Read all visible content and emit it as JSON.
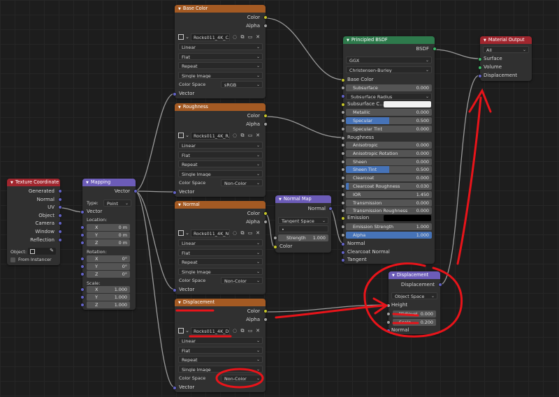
{
  "nodes": {
    "texture_coordinate": {
      "title": "Texture Coordinate",
      "outputs": [
        "Generated",
        "Normal",
        "UV",
        "Object",
        "Camera",
        "Window",
        "Reflection"
      ],
      "object_label": "Object:",
      "from_instancer": "From Instancer"
    },
    "mapping": {
      "title": "Mapping",
      "output": "Vector",
      "type_label": "Type:",
      "type_value": "Point",
      "input_vector": "Vector",
      "location_label": "Location:",
      "location": [
        {
          "axis": "X",
          "value": "0 m"
        },
        {
          "axis": "Y",
          "value": "0 m"
        },
        {
          "axis": "Z",
          "value": "0 m"
        }
      ],
      "rotation_label": "Rotation:",
      "rotation": [
        {
          "axis": "X",
          "value": "0°"
        },
        {
          "axis": "Y",
          "value": "0°"
        },
        {
          "axis": "Z",
          "value": "0°"
        }
      ],
      "scale_label": "Scale:",
      "scale": [
        {
          "axis": "X",
          "value": "1.000"
        },
        {
          "axis": "Y",
          "value": "1.000"
        },
        {
          "axis": "Z",
          "value": "1.000"
        }
      ]
    },
    "base_color": {
      "title": "Base Color",
      "out_color": "Color",
      "out_alpha": "Alpha",
      "image": "Rocks011_4K_C...",
      "interp": "Linear",
      "proj": "Flat",
      "ext": "Repeat",
      "source": "Single Image",
      "cs_label": "Color Space",
      "cs_value": "sRGB",
      "in_vector": "Vector"
    },
    "roughness": {
      "title": "Roughness",
      "out_color": "Color",
      "out_alpha": "Alpha",
      "image": "Rocks011_4K_R...",
      "interp": "Linear",
      "proj": "Flat",
      "ext": "Repeat",
      "source": "Single Image",
      "cs_label": "Color Space",
      "cs_value": "Non-Color",
      "in_vector": "Vector"
    },
    "normal": {
      "title": "Normal",
      "out_color": "Color",
      "out_alpha": "Alpha",
      "image": "Rocks011_4K_N...",
      "interp": "Linear",
      "proj": "Flat",
      "ext": "Repeat",
      "source": "Single Image",
      "cs_label": "Color Space",
      "cs_value": "Non-Color",
      "in_vector": "Vector"
    },
    "displacement_tex": {
      "title": "Displacement",
      "out_color": "Color",
      "out_alpha": "Alpha",
      "image": "Rocks011_4K_D...",
      "interp": "Linear",
      "proj": "Flat",
      "ext": "Repeat",
      "source": "Single Image",
      "cs_label": "Color Space",
      "cs_value": "Non-Color",
      "in_vector": "Vector"
    },
    "normal_map": {
      "title": "Normal Map",
      "output": "Normal",
      "space": "Tangent Space",
      "uv": "•",
      "strength_label": "Strength",
      "strength_value": "1.000",
      "in_color": "Color"
    },
    "principled": {
      "title": "Principled BSDF",
      "output": "BSDF",
      "distribution": "GGX",
      "subsurface_method": "Christensen-Burley",
      "base_color": "Base Color",
      "fields": [
        {
          "label": "Subsurface",
          "value": "0.000",
          "fill": 0
        },
        {
          "label": "Subsurface Radius",
          "value": "",
          "fill": 0,
          "dropdown": true
        },
        {
          "label": "Subsurface C...",
          "value": "",
          "fill": 0,
          "swatch": "#f2f2f2"
        },
        {
          "label": "Metallic",
          "value": "0.000",
          "fill": 0
        },
        {
          "label": "Specular",
          "value": "0.500",
          "fill": 0.5
        },
        {
          "label": "Specular Tint",
          "value": "0.000",
          "fill": 0
        }
      ],
      "roughness": "Roughness",
      "fields2": [
        {
          "label": "Anisotropic",
          "value": "0.000",
          "fill": 0
        },
        {
          "label": "Anisotropic Rotation",
          "value": "0.000",
          "fill": 0
        },
        {
          "label": "Sheen",
          "value": "0.000",
          "fill": 0
        },
        {
          "label": "Sheen Tint",
          "value": "0.500",
          "fill": 0.5
        },
        {
          "label": "Clearcoat",
          "value": "0.000",
          "fill": 0
        },
        {
          "label": "Clearcoat Roughness",
          "value": "0.030",
          "fill": 0.03
        },
        {
          "label": "IOR",
          "value": "1.450",
          "fill": 0
        },
        {
          "label": "Transmission",
          "value": "0.000",
          "fill": 0
        },
        {
          "label": "Transmission Roughness",
          "value": "0.000",
          "fill": 0
        }
      ],
      "emission": "Emission",
      "emission_strength_label": "Emission Strength",
      "emission_strength_value": "1.000",
      "alpha_label": "Alpha",
      "alpha_value": "1.000",
      "normal": "Normal",
      "clearcoat_normal": "Clearcoat Normal",
      "tangent": "Tangent"
    },
    "material_output": {
      "title": "Material Output",
      "target": "All",
      "inputs": [
        "Surface",
        "Volume",
        "Displacement"
      ]
    },
    "displacement": {
      "title": "Displacement",
      "output": "Displacement",
      "space": "Object Space",
      "height": "Height",
      "midlevel_label": "Midlevel",
      "midlevel_value": "0.000",
      "scale_label": "Scale",
      "scale_value": "0.200",
      "normal": "Normal"
    }
  },
  "colors": {
    "annotation": "#e8141a",
    "link": "#9a9a9a",
    "socket_color": "#c7c729",
    "socket_float": "#a1a1a1",
    "socket_vector": "#6363c7",
    "socket_shader": "#3dbb68"
  }
}
